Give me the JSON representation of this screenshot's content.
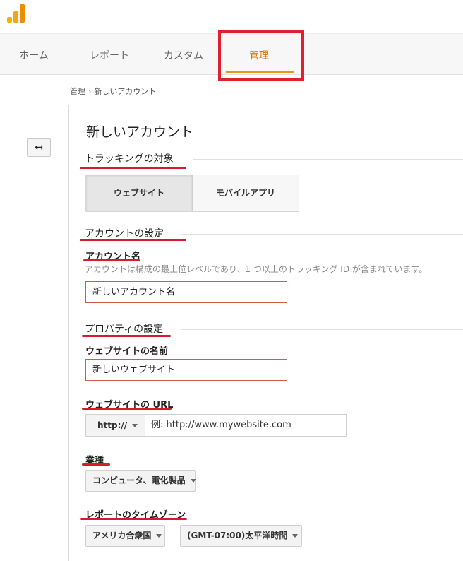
{
  "nav": {
    "tabs": [
      {
        "label": "ホーム"
      },
      {
        "label": "レポート"
      },
      {
        "label": "カスタム"
      },
      {
        "label": "管理"
      }
    ]
  },
  "breadcrumb": {
    "items": [
      "管理",
      "新しいアカウント"
    ],
    "separator": "›"
  },
  "back_button": {
    "icon": "back-arrow-icon",
    "glyph": "↤"
  },
  "page_title": "新しいアカウント",
  "tracking": {
    "title": "トラッキングの対象",
    "options": [
      "ウェブサイト",
      "モバイルアプリ"
    ],
    "selected": "ウェブサイト"
  },
  "account_settings": {
    "title": "アカウントの設定",
    "name_label": "アカウント名",
    "help": "アカウントは構成の最上位レベルであり、1 つ以上のトラッキング ID が含まれています。",
    "name_value": "新しいアカウント名"
  },
  "property_settings": {
    "title": "プロパティの設定",
    "website_name_label": "ウェブサイトの名前",
    "website_name_value": "新しいウェブサイト",
    "url_label": "ウェブサイトの URL",
    "url_protocol": "http://",
    "url_placeholder": "例: http://www.mywebsite.com",
    "industry_label": "業種",
    "industry_value": "コンピュータ、電化製品",
    "timezone_label": "レポートのタイムゾーン",
    "timezone_country": "アメリカ合衆国",
    "timezone_value": "(GMT-07:00)太平洋時間"
  },
  "colors": {
    "accent": "#e37400",
    "highlight": "#e0202c",
    "annotation": "#d81b2a"
  }
}
